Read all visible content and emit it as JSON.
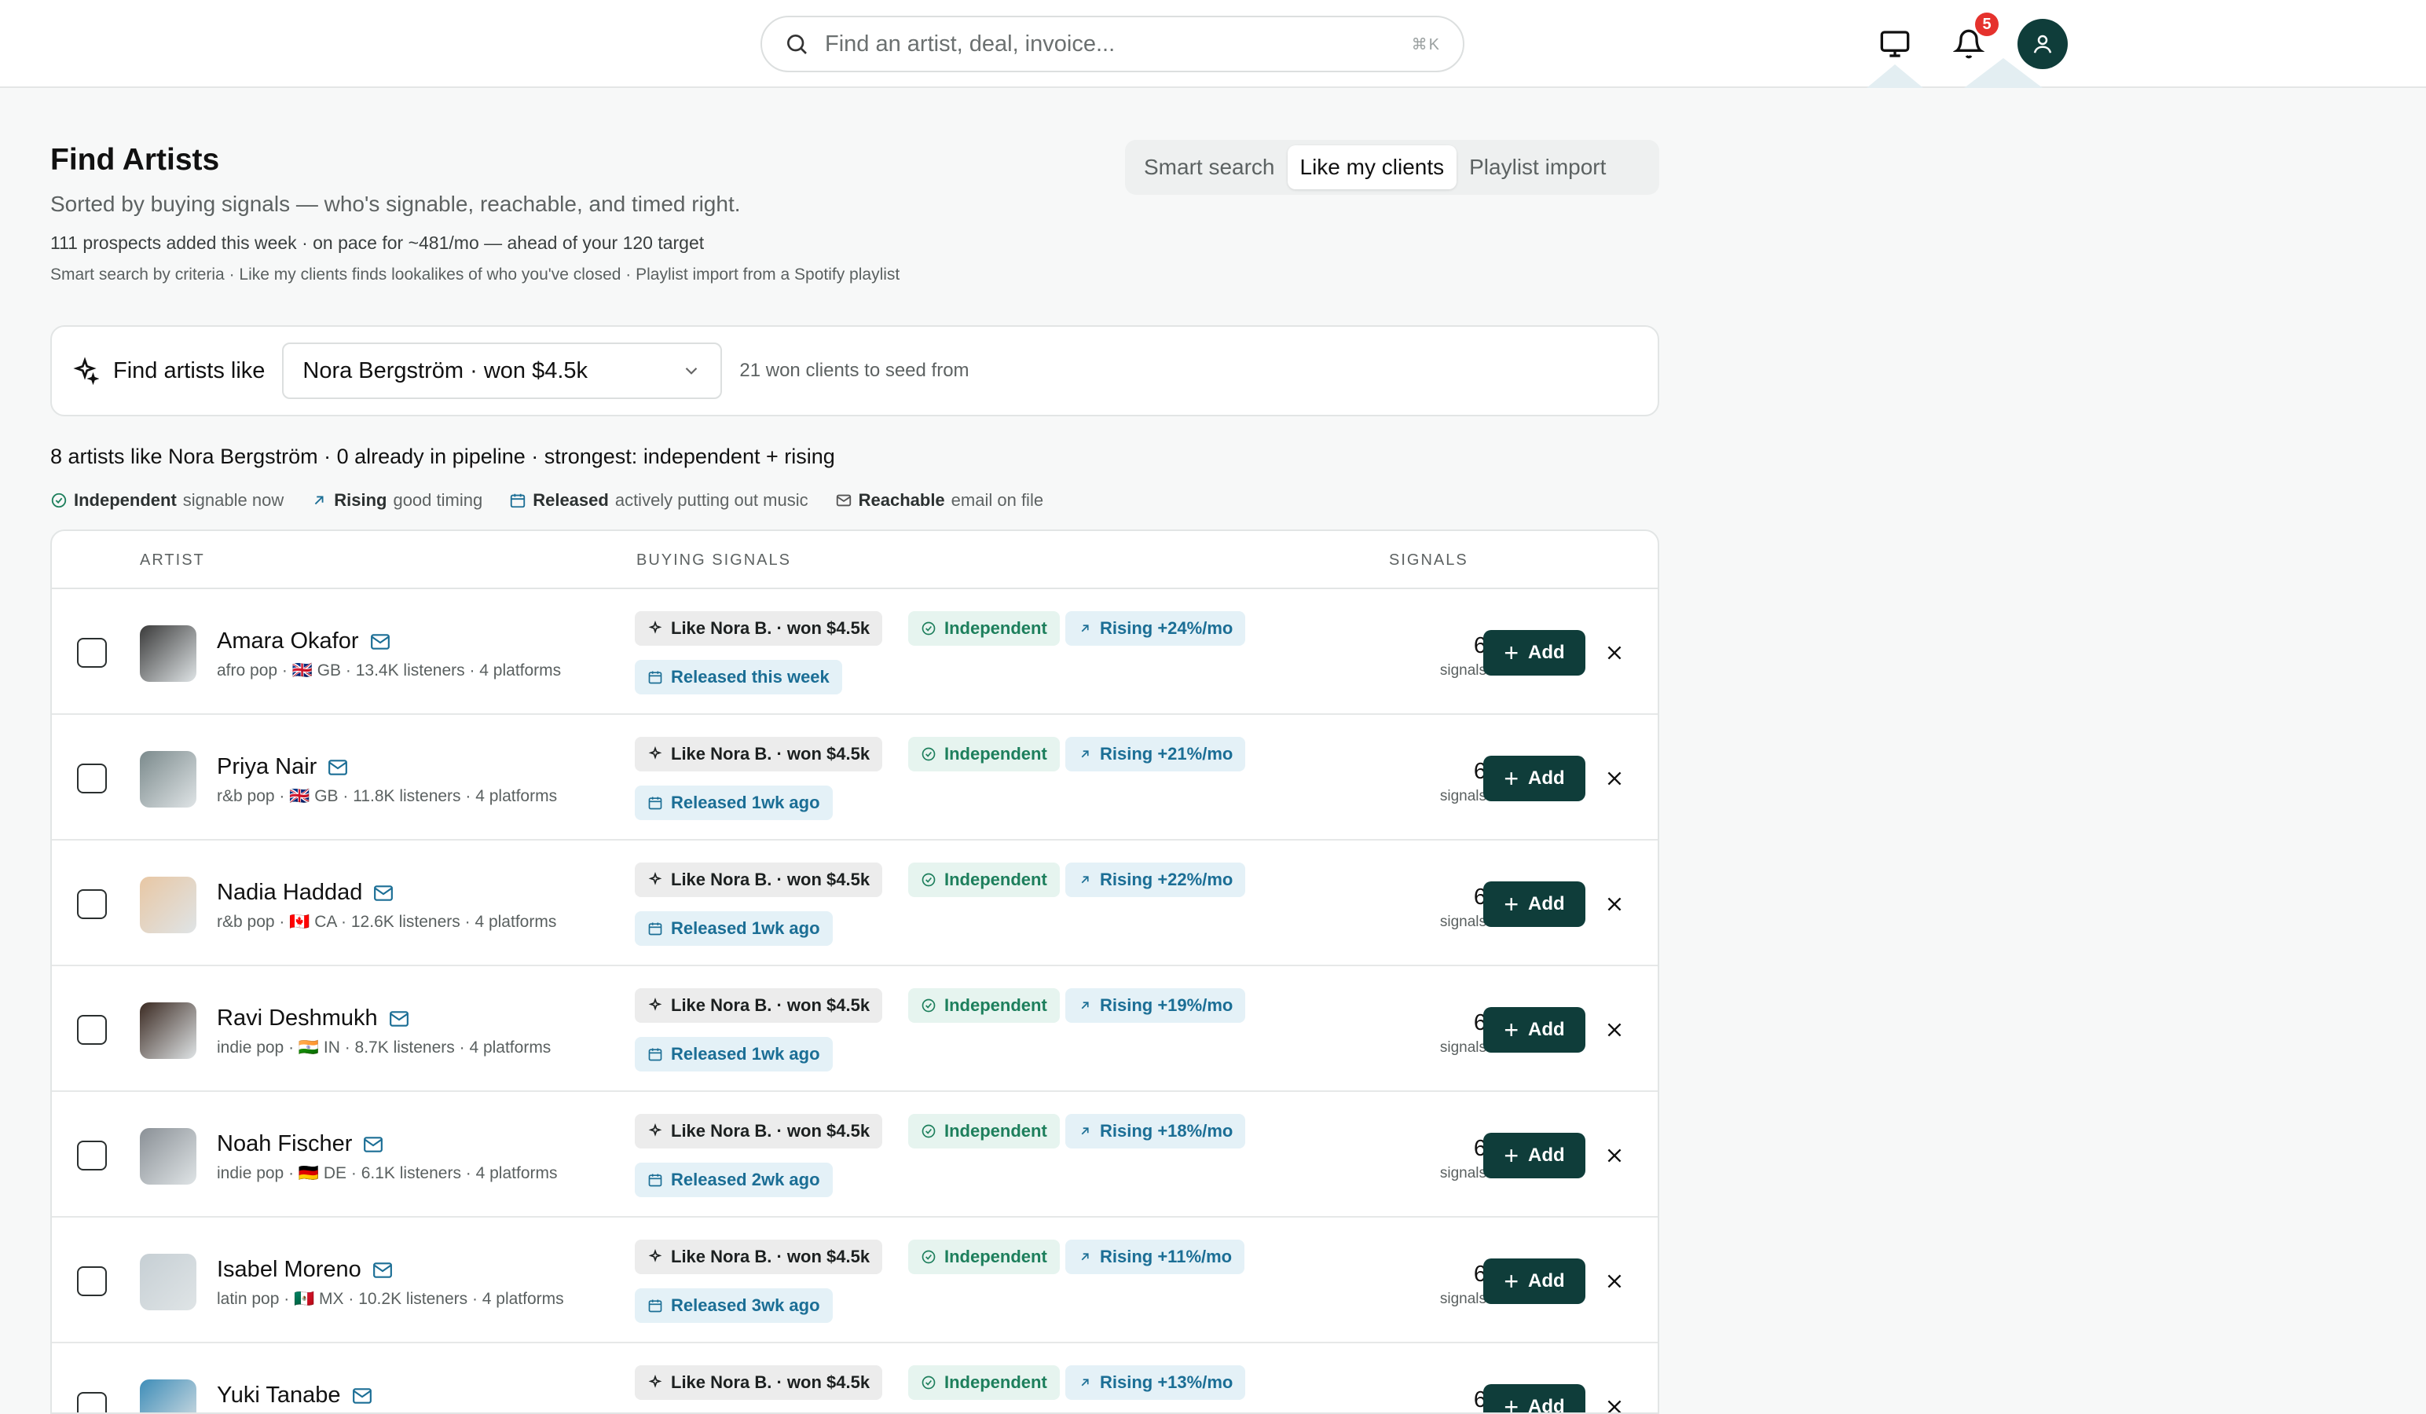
{
  "topbar": {
    "search_placeholder": "Find an artist, deal, invoice...",
    "search_shortcut": "⌘K",
    "notification_count": "5"
  },
  "page": {
    "title": "Find Artists",
    "subtitle": "Sorted by buying signals — who's signable, reachable, and timed right.",
    "pace": "111 prospects added this week · on pace for ~481/mo — ahead of your 120 target",
    "hint": "Smart search by criteria · Like my clients finds lookalikes of who you've closed · Playlist import from a Spotify playlist"
  },
  "mode_tabs": [
    "Smart search",
    "Like my clients",
    "Playlist import"
  ],
  "mode_active": "Like my clients",
  "seed": {
    "label": "Find artists like",
    "selected": "Nora Bergström · won $4.5k",
    "count": "21 won clients to seed from"
  },
  "summary": "8 artists like Nora Bergström · 0 already in pipeline · strongest: independent + rising",
  "legend": [
    {
      "key": "Independent",
      "desc": "signable now",
      "icon": "check-circle-icon"
    },
    {
      "key": "Rising",
      "desc": "good timing",
      "icon": "arrow-up-right-icon"
    },
    {
      "key": "Released",
      "desc": "actively putting out music",
      "icon": "calendar-icon"
    },
    {
      "key": "Reachable",
      "desc": "email on file",
      "icon": "mail-icon"
    }
  ],
  "table": {
    "headers": {
      "artist": "ARTIST",
      "signals_col": "BUYING SIGNALS",
      "count": "SIGNALS"
    },
    "add_label": "Add",
    "signals_label": "signals",
    "rows": [
      {
        "name": "Amara Okafor",
        "meta": "afro pop · 🇬🇧 GB · 13.4K listeners · 4 platforms",
        "like": "Like Nora B. · won $4.5k",
        "ind": "Independent",
        "rising": "Rising +24%/mo",
        "released": "Released this week",
        "signals": "6"
      },
      {
        "name": "Priya Nair",
        "meta": "r&b pop · 🇬🇧 GB · 11.8K listeners · 4 platforms",
        "like": "Like Nora B. · won $4.5k",
        "ind": "Independent",
        "rising": "Rising +21%/mo",
        "released": "Released 1wk ago",
        "signals": "6"
      },
      {
        "name": "Nadia Haddad",
        "meta": "r&b pop · 🇨🇦 CA · 12.6K listeners · 4 platforms",
        "like": "Like Nora B. · won $4.5k",
        "ind": "Independent",
        "rising": "Rising +22%/mo",
        "released": "Released 1wk ago",
        "signals": "6"
      },
      {
        "name": "Ravi Deshmukh",
        "meta": "indie pop · 🇮🇳 IN · 8.7K listeners · 4 platforms",
        "like": "Like Nora B. · won $4.5k",
        "ind": "Independent",
        "rising": "Rising +19%/mo",
        "released": "Released 1wk ago",
        "signals": "6"
      },
      {
        "name": "Noah Fischer",
        "meta": "indie pop · 🇩🇪 DE · 6.1K listeners · 4 platforms",
        "like": "Like Nora B. · won $4.5k",
        "ind": "Independent",
        "rising": "Rising +18%/mo",
        "released": "Released 2wk ago",
        "signals": "6"
      },
      {
        "name": "Isabel Moreno",
        "meta": "latin pop · 🇲🇽 MX · 10.2K listeners · 4 platforms",
        "like": "Like Nora B. · won $4.5k",
        "ind": "Independent",
        "rising": "Rising +11%/mo",
        "released": "Released 3wk ago",
        "signals": "6"
      },
      {
        "name": "Yuki Tanabe",
        "meta": "",
        "like": "Like Nora B. · won $4.5k",
        "ind": "Independent",
        "rising": "Rising +13%/mo",
        "released": "",
        "signals": "6"
      }
    ]
  },
  "colors": {
    "accent": "#0f3d3a",
    "independent": "#1d7f5c",
    "rising": "#1b6e95",
    "badge": "#e5322d"
  }
}
